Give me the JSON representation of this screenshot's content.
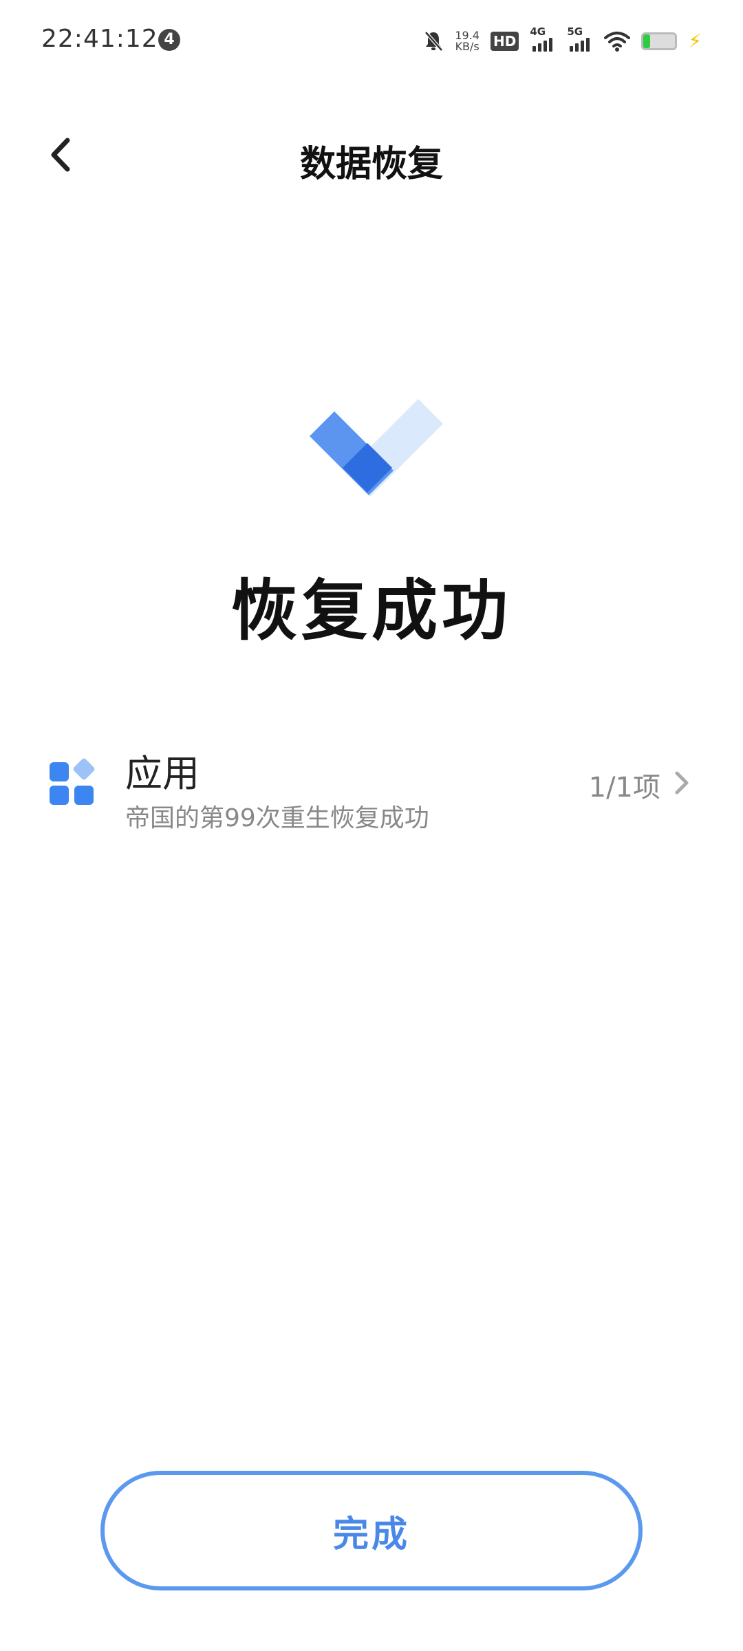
{
  "status_bar": {
    "time": "22:41:12",
    "notification_count": "4",
    "net_speed_value": "19.4",
    "net_speed_unit": "KB/s",
    "hd_label": "HD",
    "signal_1_label": "4G",
    "signal_2_label": "5G",
    "battery_level": 0.22
  },
  "header": {
    "title": "数据恢复"
  },
  "result": {
    "title": "恢复成功"
  },
  "item": {
    "title": "应用",
    "subtitle": "帝国的第99次重生恢复成功",
    "count": "1/1项"
  },
  "footer": {
    "done_label": "完成"
  },
  "colors": {
    "accent": "#4a88e8",
    "accent_border": "#5b99ef",
    "check_dark": "#2e6ddf",
    "check_mid": "#5b95f0",
    "check_light": "#dbe9fc"
  }
}
